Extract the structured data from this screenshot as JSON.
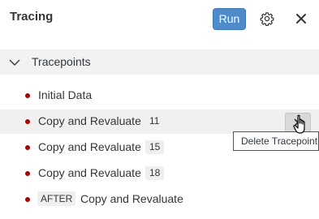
{
  "header": {
    "title": "Tracing",
    "run_label": "Run",
    "settings_icon": "gear-icon",
    "close_icon": "close-icon"
  },
  "section": {
    "label": "Tracepoints",
    "expanded_icon": "chevron-down-icon"
  },
  "tracepoints": [
    {
      "label": "Initial Data",
      "count": "",
      "prefix": ""
    },
    {
      "label": "Copy and Revaluate",
      "count": "11",
      "prefix": ""
    },
    {
      "label": "Copy and Revaluate",
      "count": "15",
      "prefix": ""
    },
    {
      "label": "Copy and Revaluate",
      "count": "18",
      "prefix": ""
    },
    {
      "label": "Copy and Revaluate",
      "count": "",
      "prefix": "AFTER"
    }
  ],
  "tooltip": {
    "text": "Delete Tracepoint"
  },
  "colors": {
    "accent": "#4f8ac9",
    "tracepoint_dot": "#a80000",
    "text": "#32363a"
  }
}
